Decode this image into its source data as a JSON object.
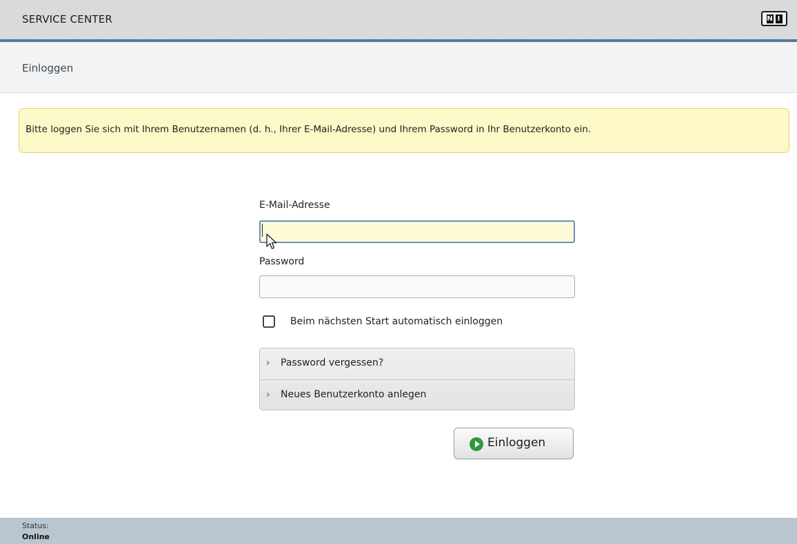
{
  "header": {
    "title": "SERVICE CENTER",
    "logo": "NI"
  },
  "page": {
    "title": "Einloggen"
  },
  "notice": {
    "text": "Bitte loggen Sie sich mit Ihrem Benutzernamen (d. h., Ihrer E-Mail-Adresse) und Ihrem Password in Ihr Benutzerkonto ein."
  },
  "form": {
    "email_label": "E-Mail-Adresse",
    "email_value": "",
    "password_label": "Password",
    "password_value": "",
    "remember_label": "Beim nächsten Start automatisch einloggen",
    "remember_checked": false,
    "links": [
      {
        "label": "Password vergessen?"
      },
      {
        "label": "Neues Benutzerkonto anlegen"
      }
    ],
    "submit_label": "Einloggen"
  },
  "status": {
    "label": "Status:",
    "value": "Online"
  },
  "colors": {
    "header_rule": "#4e7b9f",
    "notice_bg": "#fdf8c8",
    "active_field_bg": "#fdfbd8",
    "play_icon": "#2f9a3f",
    "statusbar_bg": "#bac6cf"
  },
  "icons": {
    "logo": "ni-logo-icon",
    "link_arrow": "chevron-right-icon",
    "submit": "play-circle-icon",
    "cursor": "mouse-pointer-icon"
  }
}
